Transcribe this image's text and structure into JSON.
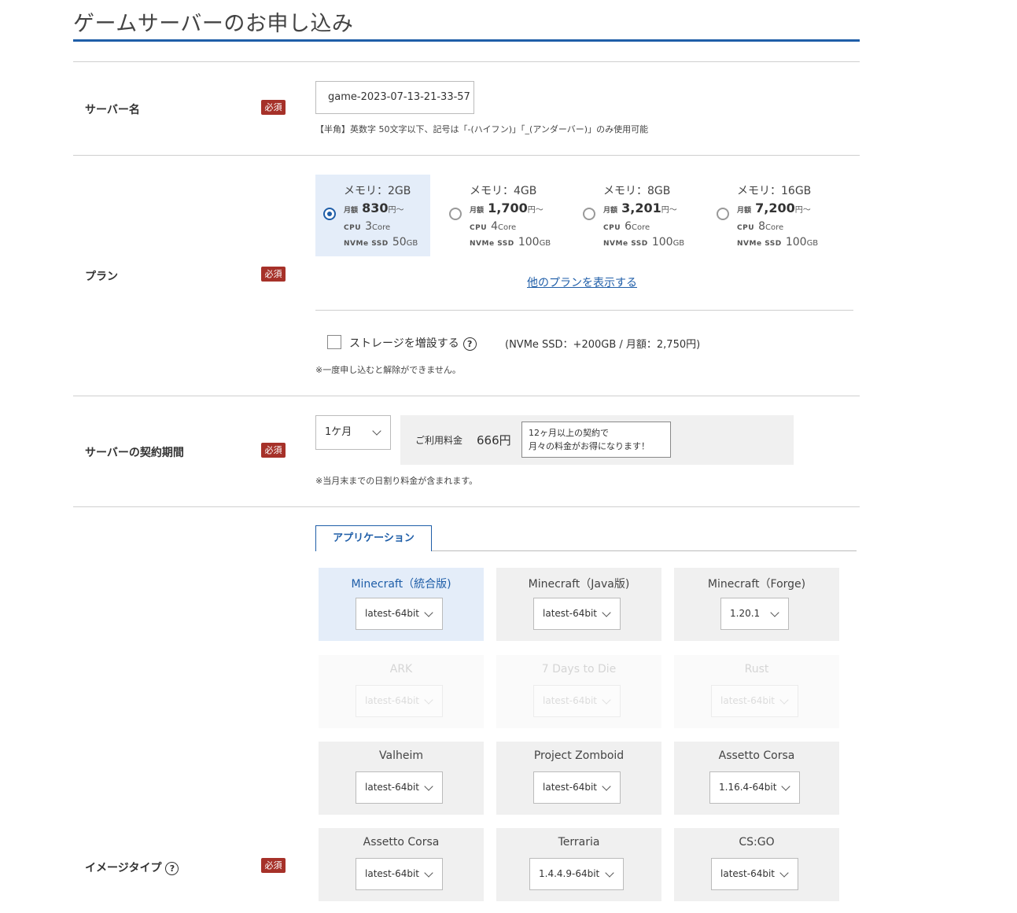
{
  "page": {
    "title": "ゲームサーバーのお申し込み"
  },
  "common": {
    "required": "必須"
  },
  "server_name": {
    "label": "サーバー名",
    "value": "game-2023-07-13-21-33-57",
    "note": "【半角】英数字 50文字以下、記号は「-(ハイフン)」「_(アンダーバー)」のみ使用可能"
  },
  "plan": {
    "label": "プラン",
    "selected_index": 0,
    "options": [
      {
        "memory": "メモリ：2GB",
        "monthly_label": "月額",
        "price": "830",
        "price_unit": "円～",
        "cpu_label": "CPU",
        "cpu": "3",
        "cpu_unit": "Core",
        "ssd_label": "NVMe SSD",
        "ssd": "50",
        "ssd_unit": "GB"
      },
      {
        "memory": "メモリ：4GB",
        "monthly_label": "月額",
        "price": "1,700",
        "price_unit": "円～",
        "cpu_label": "CPU",
        "cpu": "4",
        "cpu_unit": "Core",
        "ssd_label": "NVMe SSD",
        "ssd": "100",
        "ssd_unit": "GB"
      },
      {
        "memory": "メモリ：8GB",
        "monthly_label": "月額",
        "price": "3,201",
        "price_unit": "円～",
        "cpu_label": "CPU",
        "cpu": "6",
        "cpu_unit": "Core",
        "ssd_label": "NVMe SSD",
        "ssd": "100",
        "ssd_unit": "GB"
      },
      {
        "memory": "メモリ：16GB",
        "monthly_label": "月額",
        "price": "7,200",
        "price_unit": "円～",
        "cpu_label": "CPU",
        "cpu": "8",
        "cpu_unit": "Core",
        "ssd_label": "NVMe SSD",
        "ssd": "100",
        "ssd_unit": "GB"
      }
    ],
    "more_link": "他のプランを表示する",
    "storage_label": "ストレージを増設する",
    "storage_info": "(NVMe SSD：+200GB / 月額：2,750円)",
    "storage_note": "※一度申し込むと解除ができません。"
  },
  "period": {
    "label": "サーバーの契約期間",
    "selected": "1ケ月",
    "fee_label": "ご利用料金",
    "fee_value": "666円",
    "fee_note_line1": "12ヶ月以上の契約で",
    "fee_note_line2": "月々の料金がお得になります！",
    "note": "※当月末までの日割り料金が含まれます。"
  },
  "image_type": {
    "label": "イメージタイプ",
    "help": "?",
    "tab": "アプリケーション",
    "apps": [
      {
        "name": "Minecraft（統合版)",
        "version": "latest-64bit"
      },
      {
        "name": "Minecraft（Java版)",
        "version": "latest-64bit"
      },
      {
        "name": "Minecraft（Forge)",
        "version": "1.20.1"
      },
      {
        "name": "ARK",
        "version": "latest-64bit"
      },
      {
        "name": "7 Days to Die",
        "version": "latest-64bit"
      },
      {
        "name": "Rust",
        "version": "latest-64bit"
      },
      {
        "name": "Valheim",
        "version": "latest-64bit"
      },
      {
        "name": "Project Zomboid",
        "version": "latest-64bit"
      },
      {
        "name": "Assetto Corsa",
        "version": "1.16.4-64bit"
      },
      {
        "name": "Assetto Corsa",
        "version": "latest-64bit"
      },
      {
        "name": "Terraria",
        "version": "1.4.4.9-64bit"
      },
      {
        "name": "CS:GO",
        "version": "latest-64bit"
      }
    ]
  },
  "storage_help": "?"
}
